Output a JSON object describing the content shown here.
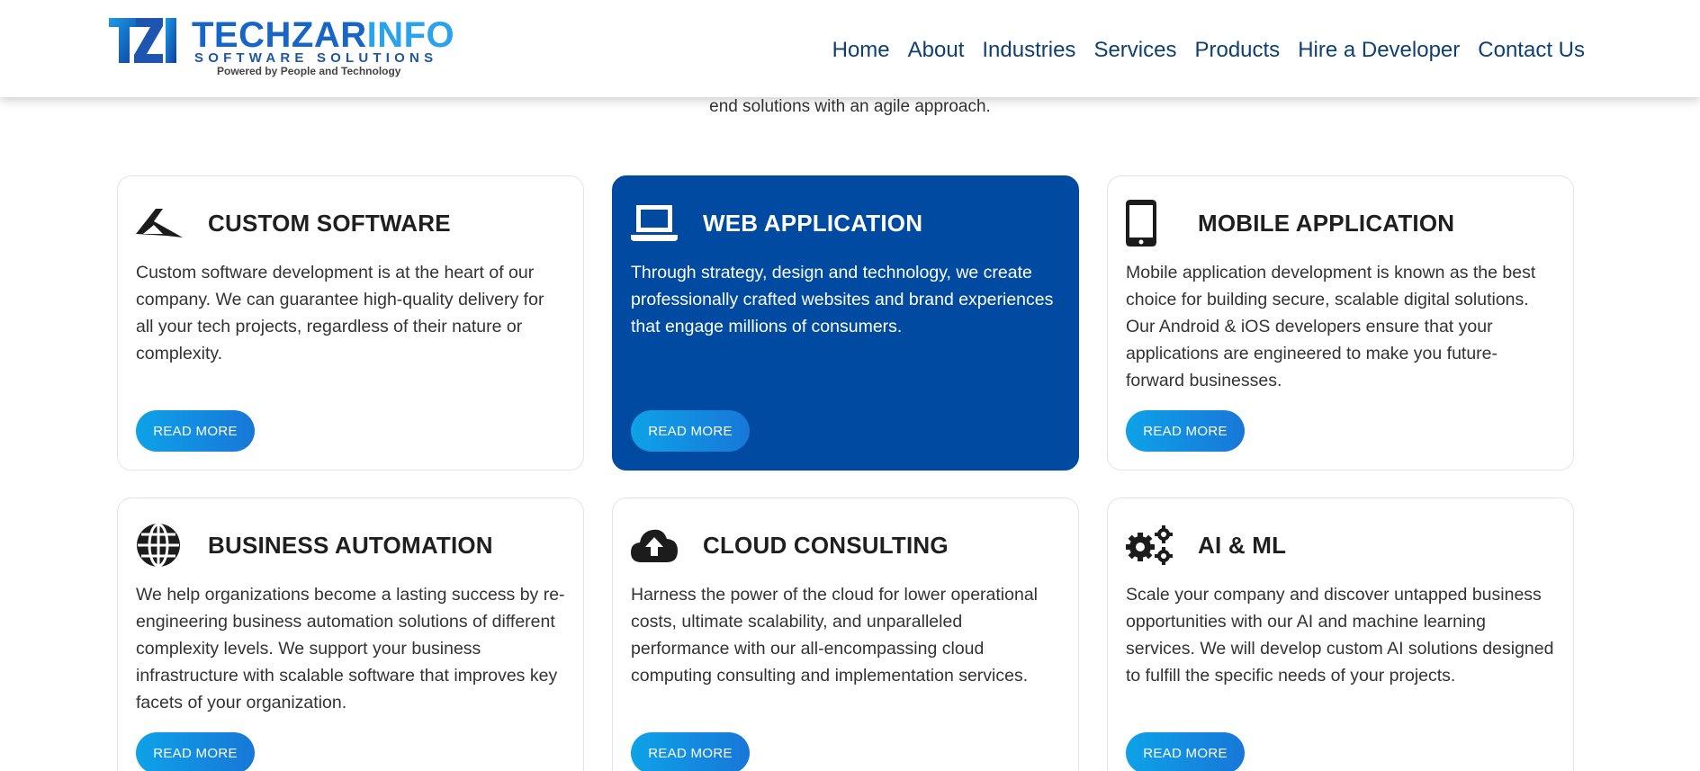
{
  "brand": {
    "name_part1": "TECHZAR",
    "name_part2": "INFO",
    "subtitle": "SOFTWARE SOLUTIONS",
    "tagline": "Powered by People and Technology"
  },
  "nav": {
    "items": [
      "Home",
      "About",
      "Industries",
      "Services",
      "Products",
      "Hire a Developer",
      "Contact Us"
    ]
  },
  "intro": {
    "text": "end solutions with an agile approach."
  },
  "cards": [
    {
      "title": "CUSTOM SOFTWARE",
      "icon": "paper-plane-icon",
      "text": "Custom software development is at the heart of our company. We can guarantee high-quality delivery for all your tech projects, regardless of their nature or complexity.",
      "button": "READ MORE"
    },
    {
      "title": "WEB APPLICATION",
      "icon": "laptop-icon",
      "text": "Through strategy, design and technology, we create professionally crafted websites and brand experiences that engage millions of consumers.",
      "button": "READ MORE"
    },
    {
      "title": "MOBILE APPLICATION",
      "icon": "mobile-phone-icon",
      "text": "Mobile application development is known as the best choice for building secure, scalable digital solutions. Our Android & iOS developers ensure that your applications are engineered to make you future-forward businesses.",
      "button": "READ MORE"
    },
    {
      "title": "BUSINESS AUTOMATION",
      "icon": "globe-icon",
      "text": "We help organizations become a lasting success by re-engineering business automation solutions of different complexity levels. We support your business infrastructure with scalable software that improves key facets of your organization.",
      "button": "READ MORE"
    },
    {
      "title": "CLOUD CONSULTING",
      "icon": "cloud-upload-icon",
      "text": "Harness the power of the cloud for lower operational costs, ultimate scalability, and unparalleled performance with our all-encompassing cloud computing consulting and implementation services.",
      "button": "READ MORE"
    },
    {
      "title": "AI & ML",
      "icon": "gears-icon",
      "text": "Scale your company and discover untapped business opportunities with our AI and machine learning services. We will develop custom AI solutions designed to fulfill the specific needs of your projects.",
      "button": "READ MORE"
    }
  ],
  "colors": {
    "active_card": "#004aa1",
    "nav_text": "#0f3f73",
    "button_gradient_start": "#0ea2e8",
    "button_gradient_end": "#1877d8"
  }
}
